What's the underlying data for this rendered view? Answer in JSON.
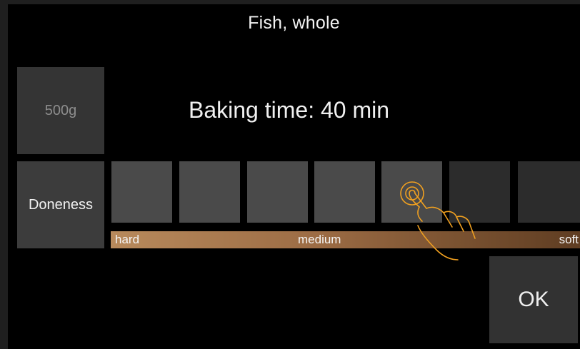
{
  "dialog": {
    "title": "Fish, whole"
  },
  "weight": {
    "label": "500g"
  },
  "baking": {
    "text": "Baking time: 40 min"
  },
  "doneness": {
    "label": "Doneness",
    "levels_total": 7,
    "selected_level": 5,
    "scale": {
      "left": "hard",
      "middle": "medium",
      "right": "soft"
    }
  },
  "actions": {
    "ok_label": "OK"
  },
  "colors": {
    "accent": "#f0a020",
    "tile": "#4a4a4a",
    "tile_unselected": "#2c2c2c",
    "scale_start": "#b88a5c",
    "scale_end": "#5f3d22"
  },
  "icons": {
    "tap_gesture": "tap-hand-icon"
  }
}
